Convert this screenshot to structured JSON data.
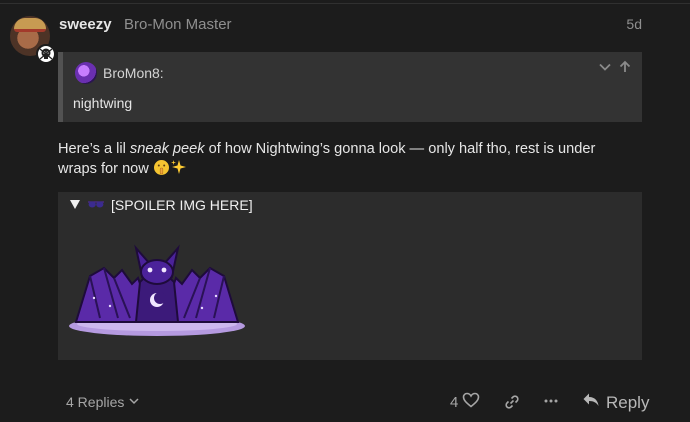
{
  "post": {
    "username": "sweezy",
    "user_title": "Bro-Mon Master",
    "date": "5d"
  },
  "quote": {
    "author": "BroMon8:",
    "text": "nightwing"
  },
  "body": {
    "text_before": "Here’s a lil ",
    "emphasis": "sneak peek",
    "text_after": " of how Nightwing’s gonna look — only half tho, rest is under wraps for now"
  },
  "spoiler": {
    "summary": "[SPOILER IMG HERE]"
  },
  "footer": {
    "replies_label": "4 Replies",
    "like_count": "4",
    "reply_label": "Reply"
  },
  "colors": {
    "background": "#1c1c1c",
    "quote_bg": "#333333",
    "spoiler_bg": "#2c2c2c",
    "accent_purple": "#7b3fd1"
  },
  "icons": [
    "chevron-down-icon",
    "arrow-up-icon",
    "heart-icon",
    "link-icon",
    "ellipsis-icon",
    "reply-arrow-icon",
    "triangle-down-icon",
    "sunglasses-icon",
    "shushing-face-icon",
    "sparkles-icon"
  ]
}
